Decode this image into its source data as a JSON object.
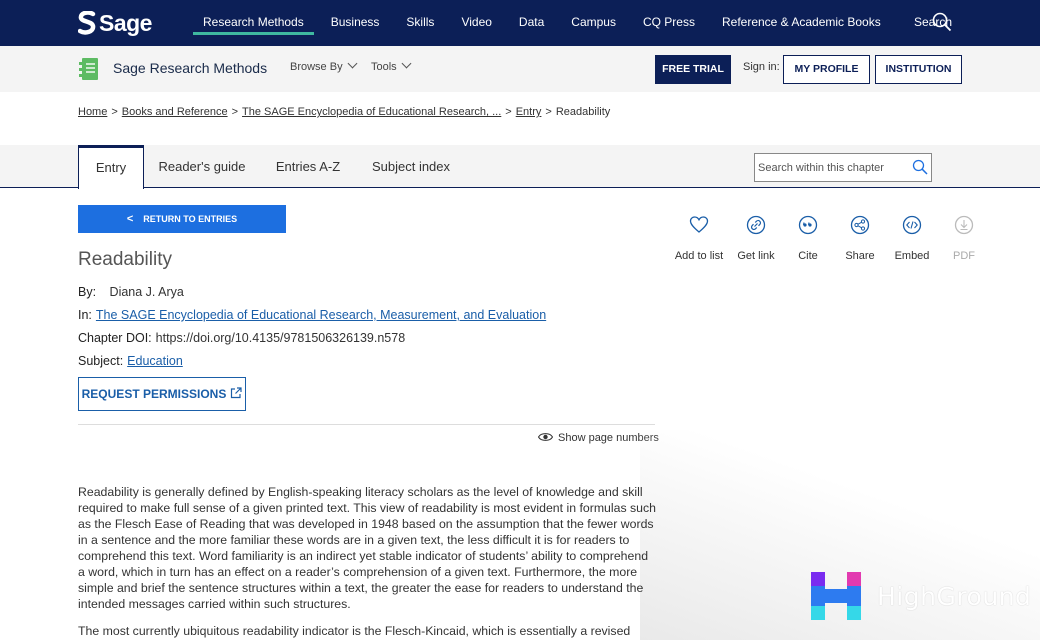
{
  "topnav": {
    "brand": "Sage",
    "links": [
      {
        "label": "Research Methods",
        "active": true
      },
      {
        "label": "Business"
      },
      {
        "label": "Skills"
      },
      {
        "label": "Video"
      },
      {
        "label": "Data"
      },
      {
        "label": "Campus"
      },
      {
        "label": "CQ Press"
      },
      {
        "label": "Reference & Academic Books"
      }
    ],
    "search_label": "Search"
  },
  "prodbar": {
    "product_name": "Sage Research Methods",
    "browse_label": "Browse By",
    "tools_label": "Tools",
    "free_trial": "FREE TRIAL",
    "signin": "Sign in:",
    "my_profile": "MY PROFILE",
    "institution": "INSTITUTION"
  },
  "breadcrumb": {
    "home": "Home",
    "books": "Books and Reference",
    "encyclopedia": "The SAGE Encyclopedia of Educational Research, ...",
    "entry": "Entry",
    "current": "Readability",
    "sep": ">"
  },
  "tabs": {
    "entry": "Entry",
    "guide": "Reader's guide",
    "az": "Entries A-Z",
    "subject": "Subject index"
  },
  "chapter_search": {
    "placeholder": "Search within this chapter"
  },
  "return_button": "RETURN TO ENTRIES",
  "return_glyph": "<",
  "entry": {
    "title": "Readability",
    "by_label": "By:",
    "author": "Diana J. Arya",
    "in_label": "In:",
    "in_value": "The SAGE Encyclopedia of Educational Research, Measurement, and Evaluation",
    "doi_label": "Chapter DOI:",
    "doi_value": "https://doi.org/10.4135/9781506326139.n578",
    "subject_label": "Subject:",
    "subject_value": "Education",
    "permissions": "REQUEST PERMISSIONS",
    "show_page_numbers": "Show page numbers",
    "paragraph_1": "Readability is generally defined by English-speaking literacy scholars as the level of knowledge and skill required to make full sense of a given printed text. This view of readability is most evident in formulas such as the Flesch Ease of Reading that was developed in 1948 based on the assumption that the fewer words in a sentence and the more familiar these words are in a given text, the less difficult it is for readers to comprehend this text. Word familiarity is an indirect yet stable indicator of students’ ability to comprehend a word, which in turn has an effect on a reader’s comprehension of a given text. Furthermore, the more simple and brief the sentence structures within a text, the greater the ease for readers to understand the intended messages carried within such structures.",
    "paragraph_2": "The most currently ubiquitous readability indicator is the Flesch-Kincaid, which is essentially a revised"
  },
  "actions": {
    "add_to_list": "Add to list",
    "get_link": "Get link",
    "cite": "Cite",
    "share": "Share",
    "embed": "Embed",
    "pdf": "PDF"
  },
  "promo": {
    "brand": "HighGround"
  },
  "colors": {
    "navy": "#0c1f57",
    "accent_blue": "#1d6fe0",
    "link_blue": "#1a5ea8",
    "nav_underline": "#3fb8a0",
    "product_green": "#5dbb63"
  }
}
